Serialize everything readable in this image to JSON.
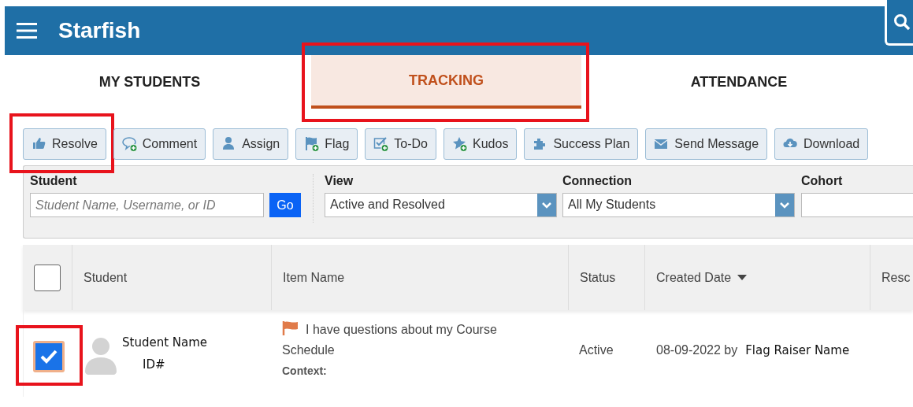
{
  "header": {
    "title": "Starfish"
  },
  "tabs": [
    {
      "label": "MY STUDENTS",
      "selected": false,
      "highlighted": false
    },
    {
      "label": "TRACKING",
      "selected": true,
      "highlighted": true
    },
    {
      "label": "ATTENDANCE",
      "selected": false,
      "highlighted": false
    }
  ],
  "toolbar": [
    {
      "label": "Resolve",
      "add_badge": false,
      "highlighted": true
    },
    {
      "label": "Comment",
      "add_badge": true,
      "highlighted": false
    },
    {
      "label": "Assign",
      "add_badge": false,
      "highlighted": false
    },
    {
      "label": "Flag",
      "add_badge": true,
      "highlighted": false
    },
    {
      "label": "To-Do",
      "add_badge": true,
      "highlighted": false
    },
    {
      "label": "Kudos",
      "add_badge": true,
      "highlighted": false
    },
    {
      "label": "Success Plan",
      "add_badge": false,
      "highlighted": false
    },
    {
      "label": "Send Message",
      "add_badge": false,
      "highlighted": false
    },
    {
      "label": "Download",
      "add_badge": false,
      "highlighted": false
    }
  ],
  "filters": {
    "student": {
      "label": "Student",
      "placeholder": "Student Name, Username, or ID",
      "button": "Go"
    },
    "view": {
      "label": "View",
      "value": "Active and Resolved"
    },
    "connection": {
      "label": "Connection",
      "value": "All My Students"
    },
    "cohort": {
      "label": "Cohort"
    }
  },
  "table": {
    "select_all": {
      "checked": false
    },
    "columns": [
      {
        "label": "Student",
        "sorted": false
      },
      {
        "label": "Item Name",
        "sorted": false
      },
      {
        "label": "Status",
        "sorted": false
      },
      {
        "label": "Created Date",
        "sorted": true
      },
      {
        "label": "Resc",
        "sorted": false
      }
    ],
    "rows": [
      {
        "checked": true,
        "highlighted": true,
        "student_name": "Student Name",
        "student_id": "ID#",
        "item_title": "I have questions about my Course Schedule",
        "context_label": "Context:",
        "status": "Active",
        "created": "08-09-2022 by",
        "created_by": "Flag Raiser Name"
      }
    ]
  }
}
